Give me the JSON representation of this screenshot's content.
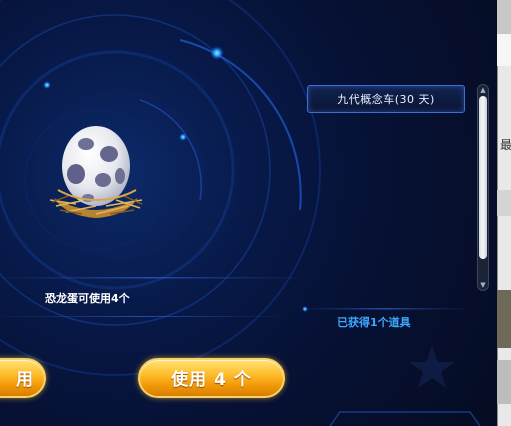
{
  "item_box": {
    "label": "九代概念车(30 天)"
  },
  "egg": {
    "count_text": "恐龙蛋可使用4个"
  },
  "reward": {
    "obtained_text": "已获得1个道具"
  },
  "buttons": {
    "left_label": "用",
    "right_label": "使用 4 个"
  },
  "side_strip": {
    "char": "最"
  },
  "colors": {
    "background": "#050c22",
    "accent_blue": "#3aa8ff",
    "button_gold": "#ffbf2e"
  }
}
